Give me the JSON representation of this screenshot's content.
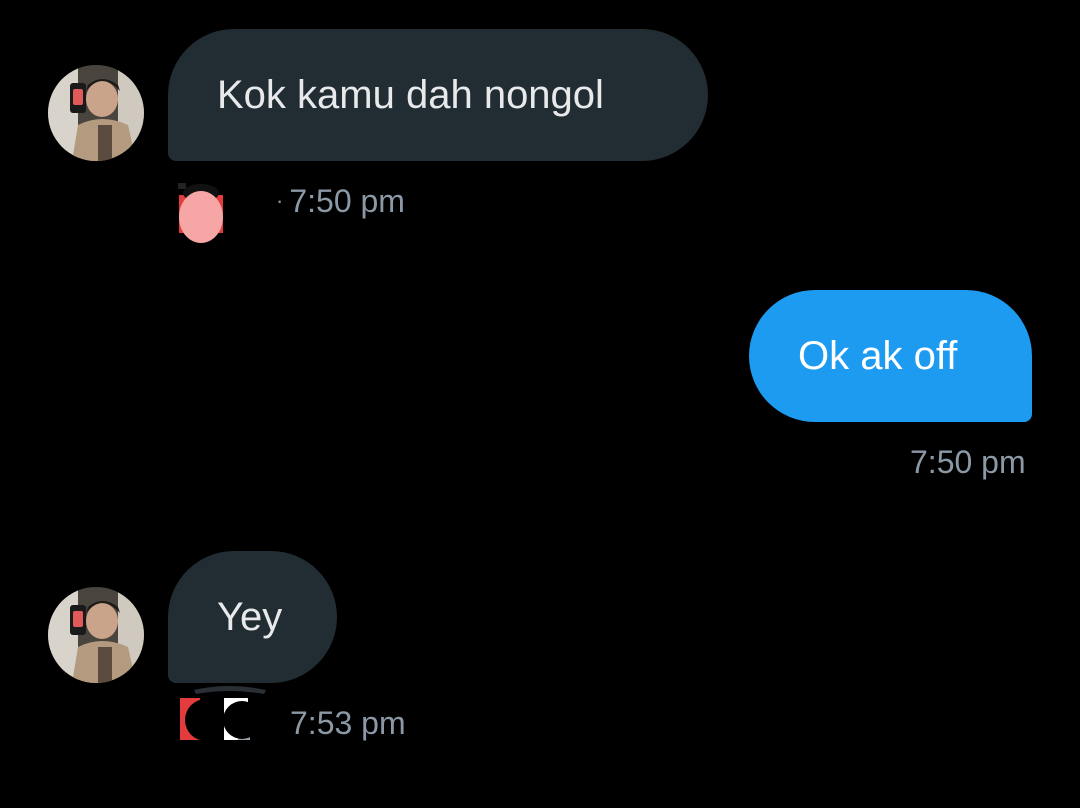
{
  "conversation": {
    "messages": [
      {
        "direction": "received",
        "text": "Kok kamu dah nongol",
        "time": "7:50 pm",
        "separator": "·",
        "has_avatar": true,
        "reaction": "red-face-emoji"
      },
      {
        "direction": "sent",
        "text": "Ok ak off",
        "time": "7:50 pm"
      },
      {
        "direction": "received",
        "text": "Yey",
        "time": "7:53 pm",
        "has_avatar": true,
        "reaction": "mixed-emoji"
      }
    ]
  },
  "colors": {
    "background": "#000000",
    "received_bubble": "#222c33",
    "sent_bubble": "#1d9bf0",
    "timestamp": "#8b98a5"
  },
  "icons": {
    "avatar": "avatar-photo-icon",
    "reaction_1": "red-face-emoji-icon",
    "reaction_2": "mixed-emoji-icon"
  }
}
